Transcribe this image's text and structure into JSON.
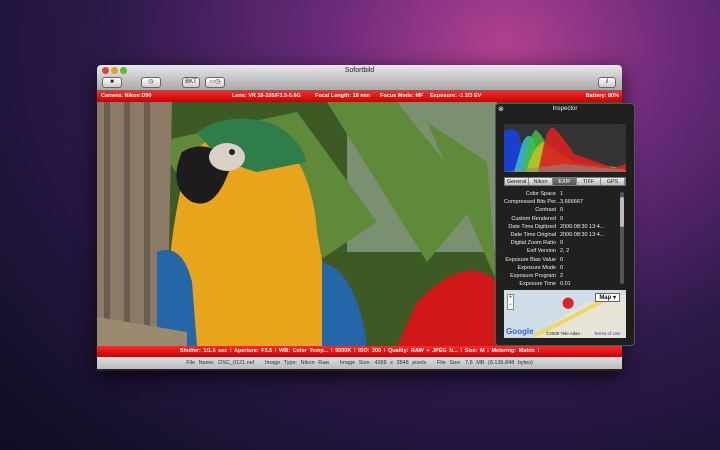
{
  "window": {
    "title": "Sofortbild"
  },
  "toolbar": {
    "capture": "camera-icon",
    "timer": "timer-icon",
    "bkt": "BKT",
    "interval": "interval-icon",
    "info": "i"
  },
  "top_bar": {
    "camera": "Camera: Nikon D90",
    "lens": "Lens: VR 18-105/F3.5-5.6G",
    "focal": "Focal Length: 18 mm",
    "focus": "Focus Mode: MF",
    "exposure": "Exposure: -1 2/3 EV",
    "battery": "Battery: 80%"
  },
  "bottom_bar": {
    "shutter": "Shutter: 1/1.6 sec",
    "aperture": "Aperture: F3.5",
    "wb": "WB: Color Temp...",
    "temp": "5000K",
    "iso": "ISO: 200",
    "quality": "Quality: RAW + JPEG N...",
    "size": "Size: M",
    "metering": "Metering: Matrix"
  },
  "status": {
    "file_name": "File Name: DSC_0121.nef",
    "image_type": "Image Type: Nikon Raw",
    "image_size": "Image Size: 4288 x 2848 pixels",
    "file_size": "File Size: 7,8 MB (8.136.848 bytes)"
  },
  "inspector": {
    "title": "Inspector",
    "tabs": [
      "General",
      "Nikon",
      "EXIF",
      "TIFF",
      "GPS"
    ],
    "active_tab": "EXIF",
    "rows": [
      [
        "Color Space",
        "1"
      ],
      [
        "Compressed Bits Per...",
        "3,666667"
      ],
      [
        "Contrast",
        "0"
      ],
      [
        "Custom Rendered",
        "0"
      ],
      [
        "Date Time Digitized",
        "2006:08:30 13:4..."
      ],
      [
        "Date Time Original",
        "2006:08:30 13:4..."
      ],
      [
        "Digital Zoom Ratio",
        "0"
      ],
      [
        "Exif Version",
        "2, 2"
      ],
      [
        "Exposure Bias Value",
        "0"
      ],
      [
        "Exposure Mode",
        "0"
      ],
      [
        "Exposure Program",
        "2"
      ],
      [
        "Exposure Time",
        "0.01"
      ]
    ],
    "map": {
      "type": "Map",
      "copyright": "©2009 Tele Atlas -",
      "terms": "Terms of Use",
      "logo": "Google"
    }
  }
}
